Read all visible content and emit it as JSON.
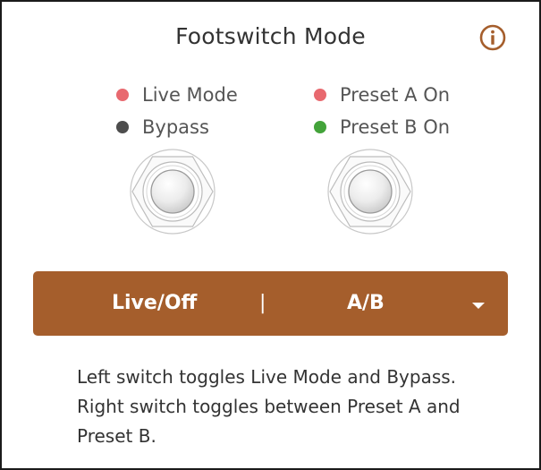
{
  "header": {
    "title": "Footswitch Mode",
    "info_icon": "info-circle-icon"
  },
  "indicators": {
    "left": [
      {
        "label": "Live Mode",
        "color": "#e8696f"
      },
      {
        "label": "Bypass",
        "color": "#4d4d4d"
      }
    ],
    "right": [
      {
        "label": "Preset A On",
        "color": "#e8696f"
      },
      {
        "label": "Preset B On",
        "color": "#43a33a"
      }
    ]
  },
  "footswitches": {
    "left_icon": "footswitch-icon",
    "right_icon": "footswitch-icon"
  },
  "mode_select": {
    "left_option": "Live/Off",
    "separator": "|",
    "right_option": "A/B",
    "dropdown_icon": "caret-down-icon",
    "color": "#a55e2c"
  },
  "description": "Left switch toggles Live Mode and Bypass. Right switch toggles between Preset A and Preset B.",
  "colors": {
    "accent": "#a55e2c",
    "text": "#333333",
    "muted_text": "#555555"
  }
}
